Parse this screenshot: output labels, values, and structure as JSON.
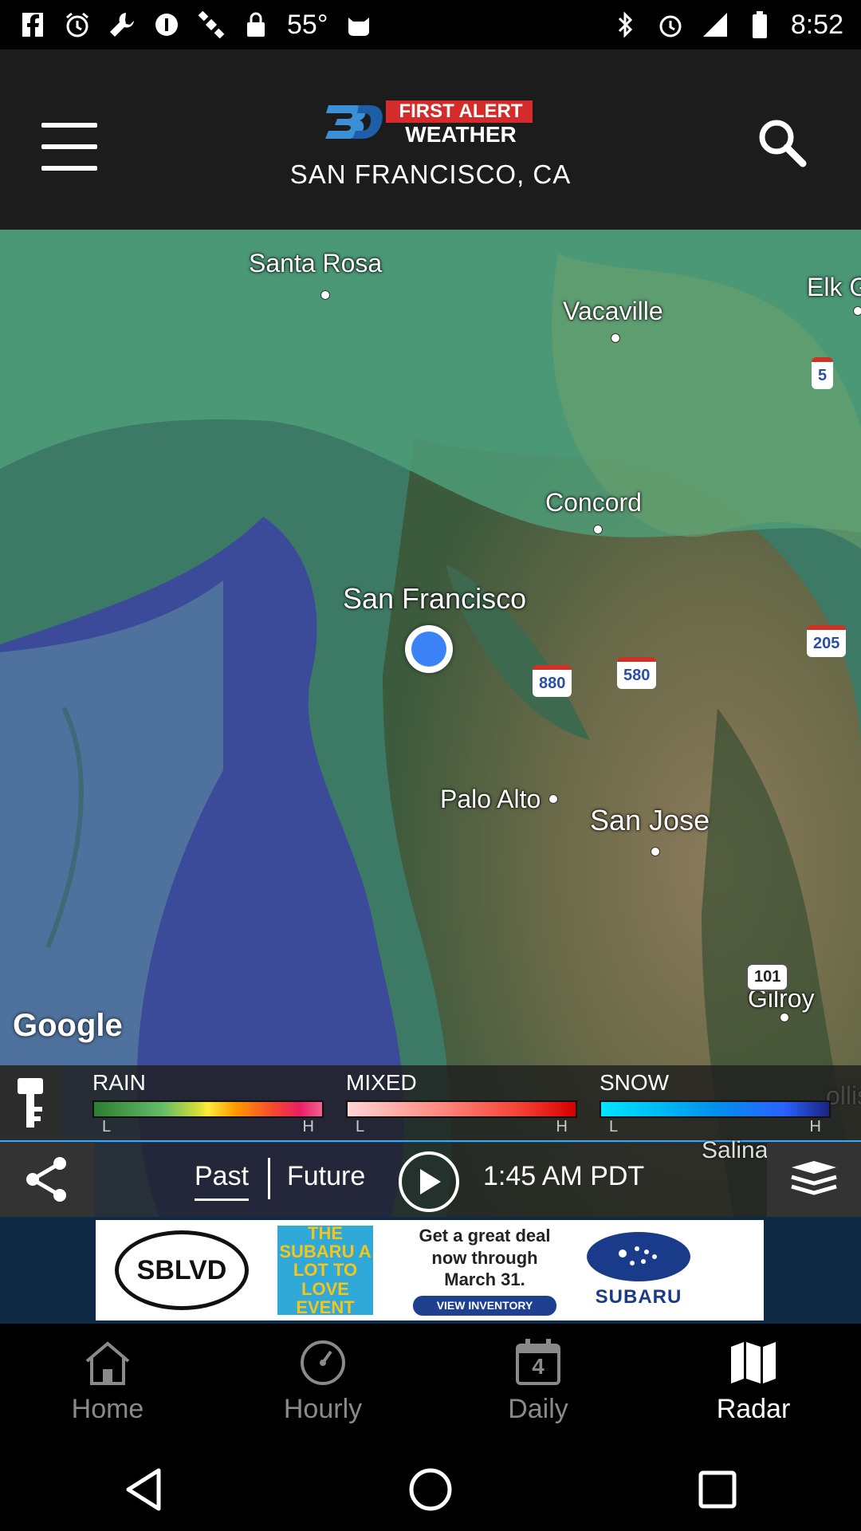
{
  "status_bar": {
    "temperature": "55°",
    "time": "8:52"
  },
  "header": {
    "logo_text_line1": "FIRST ALERT",
    "logo_text_line2": "WEATHER",
    "location": "SAN FRANCISCO, CA"
  },
  "map": {
    "attribution": "Google",
    "cities": {
      "santa_rosa": "Santa Rosa",
      "vacaville": "Vacaville",
      "elk_grove": "Elk G",
      "concord": "Concord",
      "san_francisco": "San Francisco",
      "palo_alto": "Palo Alto",
      "san_jose": "San Jose",
      "gilroy": "Gilroy",
      "hollister": "ollis"
    },
    "highways": {
      "i5": "5",
      "i880": "880",
      "i580": "580",
      "i205": "205",
      "us101": "101"
    }
  },
  "legend": {
    "rain": {
      "title": "RAIN",
      "low": "L",
      "high": "H"
    },
    "mixed": {
      "title": "MIXED",
      "low": "L",
      "high": "H"
    },
    "snow": {
      "title": "SNOW",
      "low": "L",
      "high": "H"
    }
  },
  "controls": {
    "past_label": "Past",
    "future_label": "Future",
    "time": "1:45 AM PDT",
    "salinas_label": "Salinas"
  },
  "ad": {
    "dealer_logo": "SBLVD",
    "event_text": "THE SUBARU A LOT TO LOVE EVENT",
    "offer_text": "Get a great deal now through March 31.",
    "cta": "VIEW INVENTORY",
    "brand": "SUBARU"
  },
  "bottom_nav": [
    {
      "label": "Home",
      "icon": "home-icon",
      "active": false
    },
    {
      "label": "Hourly",
      "icon": "clock-icon",
      "active": false
    },
    {
      "label": "Daily",
      "icon": "calendar-icon",
      "active": false,
      "badge": "4"
    },
    {
      "label": "Radar",
      "icon": "map-icon",
      "active": true
    }
  ]
}
